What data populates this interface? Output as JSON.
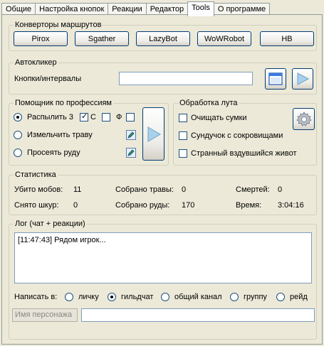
{
  "tabs": [
    "Общие",
    "Настройка кнопок",
    "Реакции",
    "Редактор",
    "Tools",
    "О программе"
  ],
  "converters": {
    "legend": "Конверторы маршрутов",
    "buttons": [
      "Pirox",
      "Sgather",
      "LazyBot",
      "WoWRobot",
      "HB"
    ]
  },
  "autoclicker": {
    "legend": "Автокликер",
    "label": "Кнопки/интервалы",
    "value": ""
  },
  "professions": {
    "legend": "Помощник по профессиям",
    "disenchant_label": "Распылить 3",
    "check_s": "С",
    "check_f": "Ф",
    "mill_label": "Измельчить траву",
    "prospect_label": "Просеять руду"
  },
  "loot": {
    "legend": "Обработка лута",
    "clean_bags": "Очищать сумки",
    "treasure_chest": "Сундучок с сокровищами",
    "strange_belly": "Странный вздувшийся живот"
  },
  "stats": {
    "legend": "Статистика",
    "mobs_label": "Убито мобов:",
    "mobs_value": "11",
    "herbs_label": "Собрано травы:",
    "herbs_value": "0",
    "deaths_label": "Смертей:",
    "deaths_value": "0",
    "skins_label": "Снято шкур:",
    "skins_value": "0",
    "ore_label": "Собрано руды:",
    "ore_value": "170",
    "time_label": "Время:",
    "time_value": "3:04:16"
  },
  "log": {
    "legend": "Лог (чат + реакции)",
    "line1": "[11:47:43] Рядом игрок...",
    "write_to": "Написать в:",
    "opt_private": "личку",
    "opt_guild": "гильдчат",
    "opt_general": "общий канал",
    "opt_group": "группу",
    "opt_raid": "рейд",
    "name_placeholder": "Имя персонажа",
    "message_value": ""
  }
}
